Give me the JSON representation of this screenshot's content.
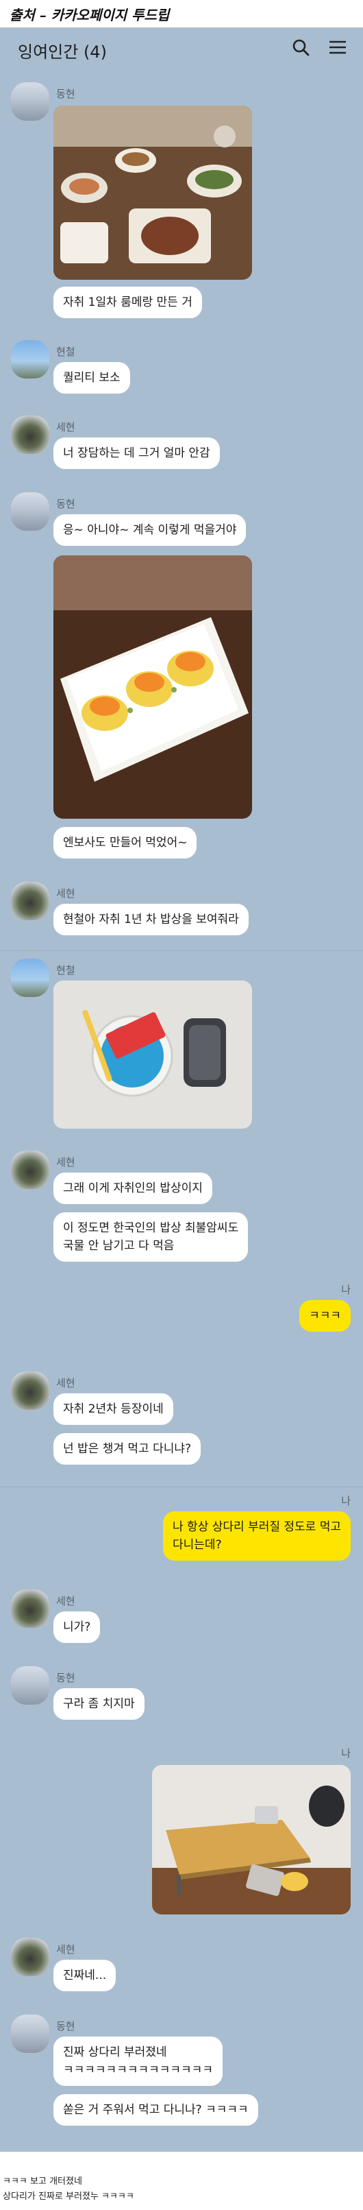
{
  "source": "출처 – 카카오페이지 투드립",
  "chat_room": {
    "title": "잉여인간 (4)"
  },
  "icons": {
    "search": "search-icon",
    "menu": "hamburger-menu-icon"
  },
  "me_label": "나",
  "messages": [
    {
      "sender": "동현",
      "photo": "home-cooked-dinner-table-photo"
    },
    {
      "text": "자취 1일차 룸메랑 만든 거"
    },
    {
      "sender": "현철",
      "text": "퀄리티 보소"
    },
    {
      "sender": "세현",
      "text": "너 장담하는 데 그거 얼마 안감"
    },
    {
      "sender": "동현",
      "text": "응~ 아니야~ 계속 이렇게 먹을거야"
    },
    {
      "photo": "egg-sandwich-plate-photo"
    },
    {
      "text": "엔보사도 만들어 먹었어~"
    },
    {
      "sender": "세현",
      "text": "현철아 자취 1년 차 밥상을 보여줘라"
    },
    {
      "sender": "현철",
      "photo": "cup-noodle-and-rice-photo"
    },
    {
      "sender": "세현",
      "text": "그래 이게 자취인의 밥상이지"
    },
    {
      "text": "이 정도면 한국인의 밥상 최불암씨도\n국물 안 남기고 다 먹음"
    },
    {
      "sender": "나",
      "text": "ㅋㅋㅋ"
    },
    {
      "sender": "세현",
      "text": "자취 2년차 등장이네"
    },
    {
      "text": "넌 밥은 챙겨 먹고 다니냐?"
    },
    {
      "sender": "나",
      "text": "나 항상 상다리 부러질 정도로 먹고\n다니는데?"
    },
    {
      "sender": "세현",
      "text": "니가?"
    },
    {
      "sender": "동현",
      "text": "구라 좀 치지마"
    },
    {
      "sender": "나",
      "photo": "broken-table-photo"
    },
    {
      "sender": "세현",
      "text": "진짜네..."
    },
    {
      "sender": "동현",
      "text": "진짜 상다리 부러졌네\nㅋㅋㅋㅋㅋㅋㅋㅋㅋㅋㅋㅋㅋㅋ"
    },
    {
      "text": "쏟은 거 주워서 먹고 다니나? ㅋㅋㅋㅋ"
    }
  ],
  "footer": {
    "line1": "ㅋㅋㅋ 보고 개터졌네",
    "line2": "상다리가 진짜로 부러졌누 ㅋㅋㅋㅋ"
  }
}
